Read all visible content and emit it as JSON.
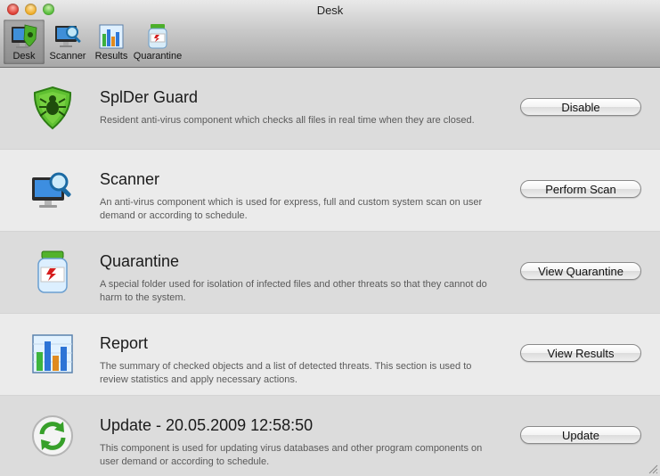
{
  "window": {
    "title": "Desk"
  },
  "toolbar": {
    "items": [
      {
        "label": "Desk",
        "icon": "desk-icon",
        "selected": true
      },
      {
        "label": "Scanner",
        "icon": "scanner-icon",
        "selected": false
      },
      {
        "label": "Results",
        "icon": "results-icon",
        "selected": false
      },
      {
        "label": "Quarantine",
        "icon": "quarantine-icon",
        "selected": false
      }
    ]
  },
  "components": [
    {
      "title": "SplDer Guard",
      "description": "Resident anti-virus component which checks all files in real time when they are closed.",
      "button": "Disable",
      "icon": "spider-guard-icon"
    },
    {
      "title": "Scanner",
      "description": "An anti-virus component which is used for express, full and custom system scan on user demand or according to schedule.",
      "button": "Perform Scan",
      "icon": "scanner-icon"
    },
    {
      "title": "Quarantine",
      "description": "A special folder used for isolation of infected files and other threats so that they cannot do harm to the system.",
      "button": "View Quarantine",
      "icon": "quarantine-jar-icon"
    },
    {
      "title": "Report",
      "description": "The summary of checked objects and a list of detected threats. This section is used to review statistics and apply necessary actions.",
      "button": "View Results",
      "icon": "report-chart-icon"
    },
    {
      "title": "Update - 20.05.2009 12:58:50",
      "description": "This component is used for updating virus databases and other program components on user demand or according to schedule.",
      "button": "Update",
      "icon": "update-icon"
    }
  ]
}
